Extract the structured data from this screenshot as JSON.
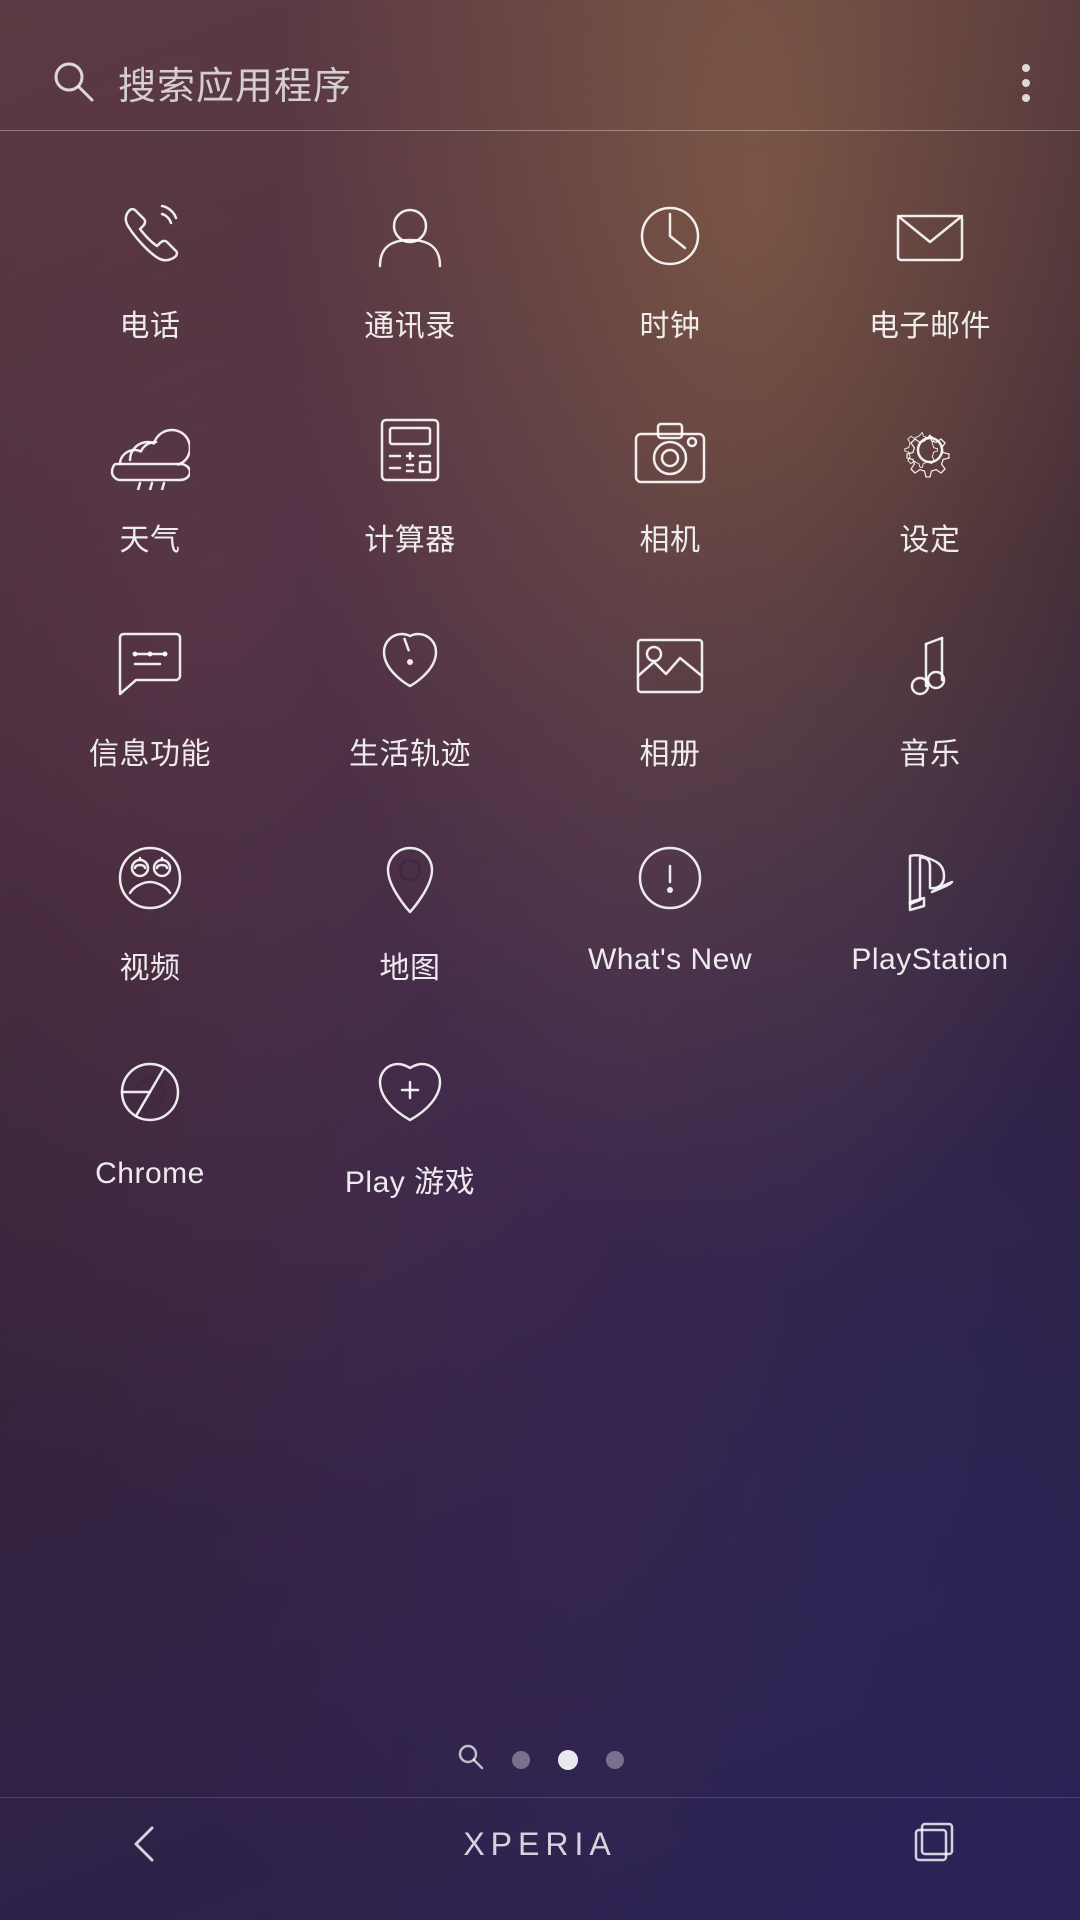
{
  "search": {
    "placeholder": "搜索应用程序"
  },
  "brand": "XPERIA",
  "apps": [
    {
      "id": "phone",
      "label": "电话",
      "icon": "phone"
    },
    {
      "id": "contacts",
      "label": "通讯录",
      "icon": "contacts"
    },
    {
      "id": "clock",
      "label": "时钟",
      "icon": "clock"
    },
    {
      "id": "email",
      "label": "电子邮件",
      "icon": "email"
    },
    {
      "id": "weather",
      "label": "天气",
      "icon": "weather"
    },
    {
      "id": "calculator",
      "label": "计算器",
      "icon": "calculator"
    },
    {
      "id": "camera",
      "label": "相机",
      "icon": "camera"
    },
    {
      "id": "settings",
      "label": "设定",
      "icon": "settings"
    },
    {
      "id": "messages",
      "label": "信息功能",
      "icon": "messages"
    },
    {
      "id": "lifelog",
      "label": "生活轨迹",
      "icon": "lifelog"
    },
    {
      "id": "album",
      "label": "相册",
      "icon": "album"
    },
    {
      "id": "music",
      "label": "音乐",
      "icon": "music"
    },
    {
      "id": "video",
      "label": "视频",
      "icon": "video"
    },
    {
      "id": "maps",
      "label": "地图",
      "icon": "maps"
    },
    {
      "id": "whatsnew",
      "label": "What's New",
      "icon": "whatsnew"
    },
    {
      "id": "playstation",
      "label": "PlayStation",
      "icon": "playstation"
    },
    {
      "id": "chrome",
      "label": "Chrome",
      "icon": "chrome"
    },
    {
      "id": "playgames",
      "label": "Play 游戏",
      "icon": "playgames"
    }
  ],
  "nav": {
    "back": "back",
    "recent": "recent"
  }
}
